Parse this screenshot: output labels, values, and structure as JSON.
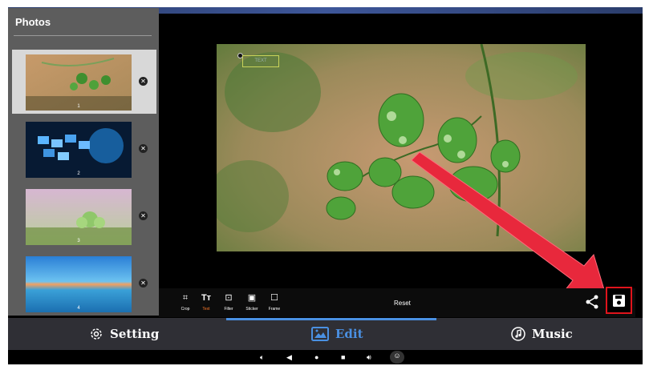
{
  "sidebar": {
    "title": "Photos",
    "items": [
      {
        "num": "1",
        "selected": true
      },
      {
        "num": "2",
        "selected": false
      },
      {
        "num": "3",
        "selected": false
      },
      {
        "num": "4",
        "selected": false
      }
    ],
    "delete_icon": "close-circle-icon"
  },
  "editor": {
    "text_overlay": "TEXT",
    "tools": [
      {
        "label": "Crop",
        "icon": "crop-icon"
      },
      {
        "label": "Text",
        "icon": "text-icon"
      },
      {
        "label": "Filter",
        "icon": "filter-icon"
      },
      {
        "label": "Sticker",
        "icon": "sticker-icon"
      },
      {
        "label": "Frame",
        "icon": "frame-icon"
      }
    ],
    "active_tool": "Text",
    "reset_label": "Reset"
  },
  "bottom_nav": {
    "tabs": [
      {
        "label": "Setting",
        "icon": "gear-icon"
      },
      {
        "label": "Edit",
        "icon": "image-icon"
      },
      {
        "label": "Music",
        "icon": "music-note-icon"
      }
    ],
    "active": "Edit"
  },
  "colors": {
    "accent": "#4a90e2",
    "active_tool": "#ff7a2a",
    "highlight": "#e0141c",
    "sidebar_bg": "#5d5d5d",
    "nav_bg": "#2f2f35"
  }
}
